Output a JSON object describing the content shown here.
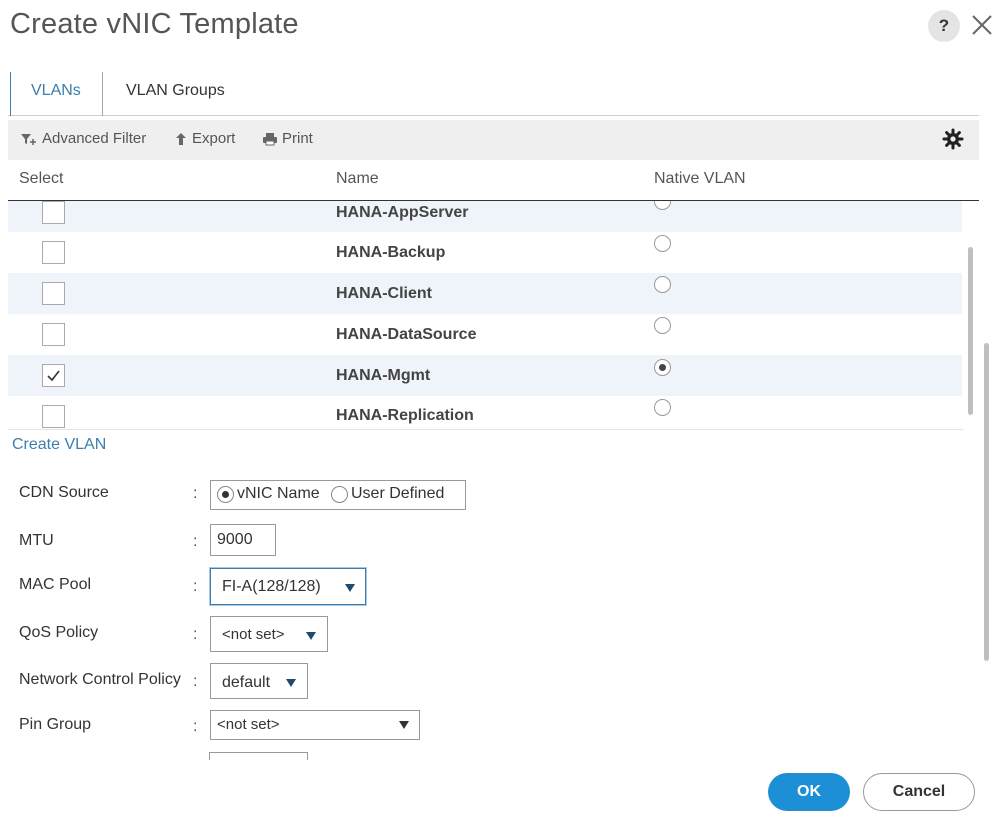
{
  "dialog": {
    "title": "Create vNIC Template",
    "help_label": "?"
  },
  "tabs": [
    {
      "label": "VLANs",
      "active": true
    },
    {
      "label": "VLAN Groups",
      "active": false
    }
  ],
  "toolbar": {
    "advanced_filter": "Advanced Filter",
    "export": "Export",
    "print": "Print"
  },
  "table": {
    "columns": [
      "Select",
      "Name",
      "Native VLAN"
    ],
    "rows": [
      {
        "name": "HANA-AppServer",
        "selected": false,
        "native": false
      },
      {
        "name": "HANA-Backup",
        "selected": false,
        "native": false
      },
      {
        "name": "HANA-Client",
        "selected": false,
        "native": false
      },
      {
        "name": "HANA-DataSource",
        "selected": false,
        "native": false
      },
      {
        "name": "HANA-Mgmt",
        "selected": true,
        "native": true
      },
      {
        "name": "HANA-Replication",
        "selected": false,
        "native": false
      }
    ]
  },
  "create_vlan_link": "Create VLAN",
  "form": {
    "colon": ":",
    "cdn_source": {
      "label": "CDN Source",
      "options": [
        "vNIC Name",
        "User Defined"
      ],
      "selected": "vNIC Name"
    },
    "mtu": {
      "label": "MTU",
      "value": "9000"
    },
    "mac_pool": {
      "label": "MAC Pool",
      "value": "FI-A(128/128)"
    },
    "qos_policy": {
      "label": "QoS Policy",
      "value": "<not set>"
    },
    "network_control_policy": {
      "label": "Network Control Policy",
      "value": "default"
    },
    "pin_group": {
      "label": "Pin Group",
      "value": "<not set>"
    }
  },
  "buttons": {
    "ok": "OK",
    "cancel": "Cancel"
  },
  "colors": {
    "accent": "#3c7eae",
    "primary_button": "#1d8fd6"
  }
}
